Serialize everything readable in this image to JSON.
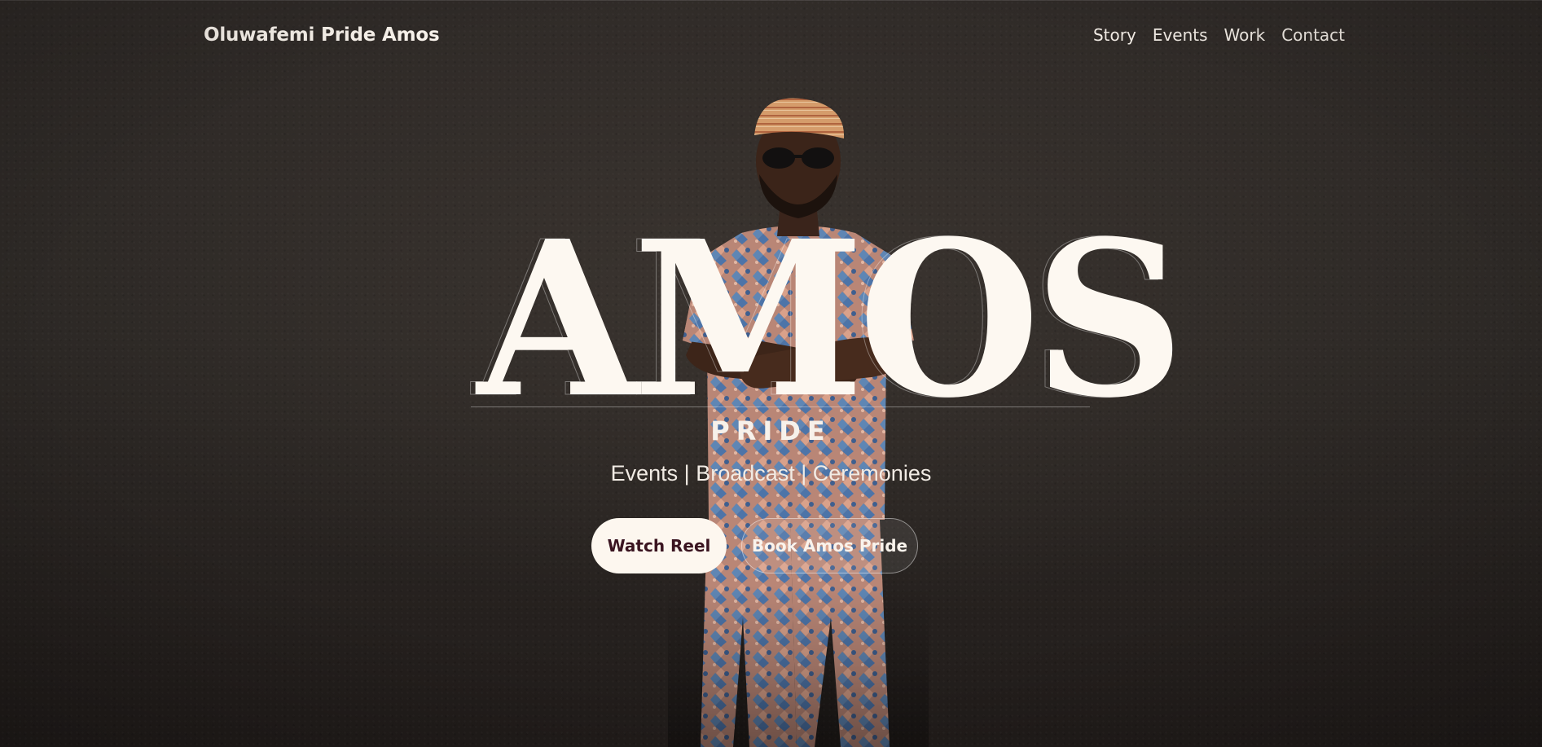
{
  "nav": {
    "brand": "Oluwafemi Pride Amos",
    "links": [
      "Story",
      "Events",
      "Work",
      "Contact"
    ]
  },
  "hero": {
    "wordmark": "AMOS",
    "subname": "PRIDE",
    "tagline": "Events | Broadcast | Ceremonies",
    "primary_button": "Watch Reel",
    "secondary_button": "Book Amos Pride"
  },
  "colors": {
    "background": "#2c2825",
    "text": "#fdf8f1",
    "primary_button_bg": "#fdf7ef",
    "primary_button_text": "#3a1420"
  }
}
